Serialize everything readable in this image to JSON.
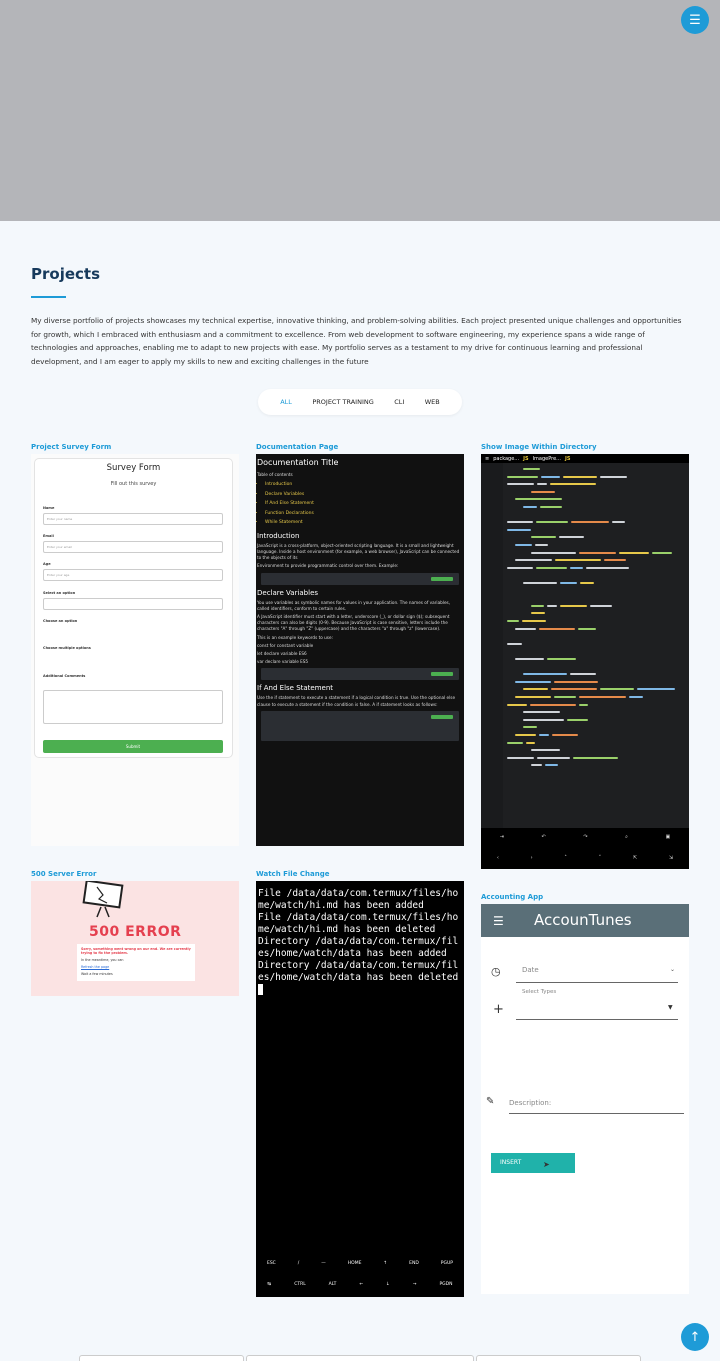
{
  "nav": {
    "menu_icon": "☰",
    "up_icon": "↑"
  },
  "section": {
    "title": "Projects",
    "description": "My diverse portfolio of projects showcases my technical expertise, innovative thinking, and problem-solving abilities. Each project presented unique challenges and opportunities for growth, which I embraced with enthusiasm and a commitment to excellence. From web development to software engineering, my experience spans a wide range of technologies and approaches, enabling me to adapt to new projects with ease. My portfolio serves as a testament to my drive for continuous learning and professional development, and I am eager to apply my skills to new and exciting challenges in the future"
  },
  "filters": [
    "ALL",
    "PROJECT TRAINING",
    "CLI",
    "WEB"
  ],
  "active_filter": "ALL",
  "projects": [
    {
      "title": "Project Survey Form"
    },
    {
      "title": "Documentation Page"
    },
    {
      "title": "Show Image Within Directory"
    },
    {
      "title": "500 Server Error"
    },
    {
      "title": "Watch File Change"
    },
    {
      "title": "Accounting App"
    }
  ],
  "survey": {
    "heading": "Survey Form",
    "subheading": "Fill out this survey",
    "labels": [
      "Name",
      "Email",
      "Age",
      "Select an option",
      "Choose an option",
      "Choose multiple options",
      "Additional Comments"
    ],
    "placeholders": [
      "Enter your name",
      "Enter your email",
      "Enter your age"
    ],
    "submit": "Submit"
  },
  "doc": {
    "title": "Documentation Title",
    "toc": "Table of contents",
    "toc_items": [
      "Introduction",
      "Declare Variables",
      "If And Else Statement",
      "Function Declarations",
      "While Statement"
    ],
    "intro_h": "Introduction",
    "intro_p": "JavaScript is a cross-platform, object-oriented scripting language. It is a small and lightweight language. Inside a host environment (for example, a web browser), JavaScript can be connected to the objects of its",
    "intro_p2": "Environment to provide programmatic control over them. Example:",
    "vars_h": "Declare Variables",
    "vars_p": "You use variables as symbolic names for values in your application. The names of variables, called identifiers, conform to certain rules.",
    "vars_p2": "A JavaScript identifier must start with a letter, underscore (_), or dollar sign ($); subsequent characters can also be digits (0-9). Because JavaScript is case sensitive, letters include the characters \"A\" through \"Z\" (uppercase) and the characters \"a\" through \"z\" (lowercase).",
    "vars_p3": "This is an example keywords to use:",
    "kw_items": [
      "const for constant variable",
      "let declare variable ES6",
      "var declare variable ES5"
    ],
    "if_h": "If And Else Statement",
    "if_p": "Use the if statement to execute a statement if a logical condition is true. Use the optional else clause to execute a statement if the condition is false. A if statement looks as follows:"
  },
  "code_screen": {
    "tab1": "package...",
    "tab2": "JS",
    "tab3": "ImagePre...",
    "tab4": "JS"
  },
  "error_page": {
    "code_text": "500 ERROR",
    "line1": "Sorry, something went wrong on our end. We are currently trying to fix the problem.",
    "line2": "In the meantime, you can",
    "opt1": "Refresh the page",
    "opt2": "Wait a few minutes"
  },
  "terminal": {
    "output": "File /data/data/com.termux/files/home/watch/hi.md has been added\nFile /data/data/com.termux/files/home/watch/hi.md has been deleted\nDirectory /data/data/com.termux/files/home/watch/data has been added\nDirectory /data/data/com.termux/files/home/watch/data has been deleted\n",
    "keys_row1": [
      "ESC",
      "/",
      "—",
      "HOME",
      "↑",
      "END",
      "PGUP"
    ],
    "keys_row2": [
      "↹",
      "CTRL",
      "ALT",
      "←",
      "↓",
      "→",
      "PGDN"
    ]
  },
  "accounting": {
    "app_name": "AccounTunes",
    "date_label": "Date",
    "type_label": "Select Types",
    "desc_label": "Description:",
    "insert_label": "INSERT"
  }
}
